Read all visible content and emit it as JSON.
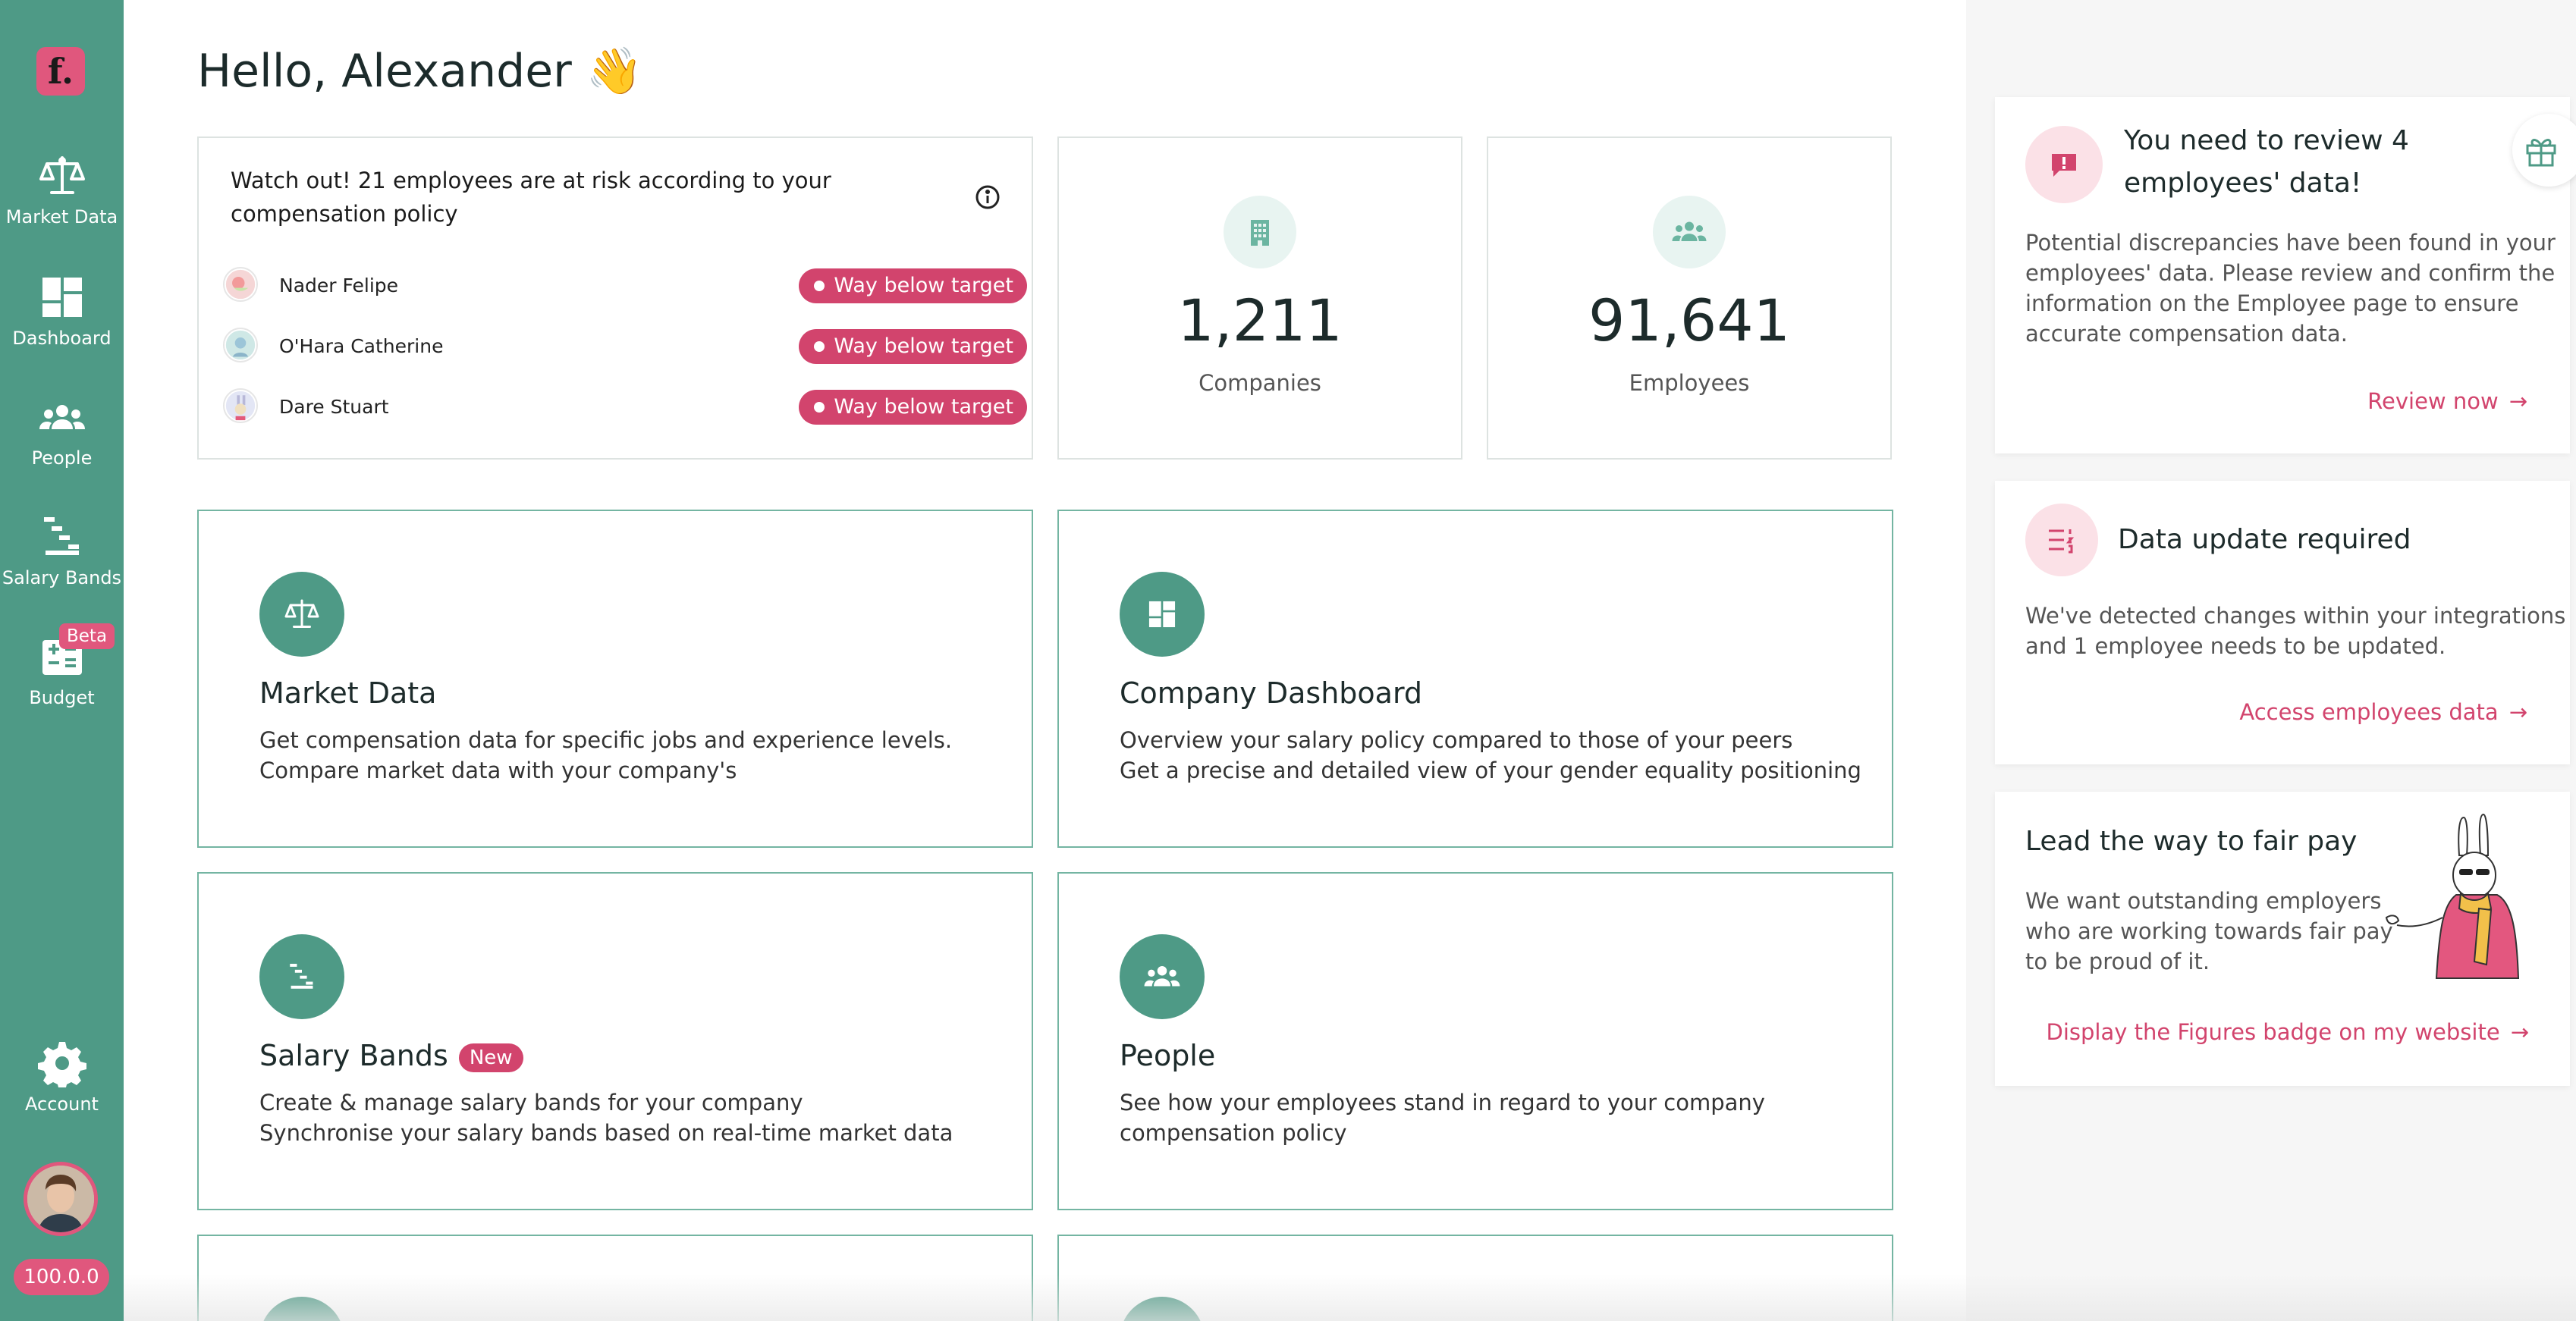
{
  "app": {
    "logo_text": "f.",
    "version": "100.0.0"
  },
  "sidebar": {
    "items": [
      {
        "label": "Market Data",
        "icon": "scale-icon"
      },
      {
        "label": "Dashboard",
        "icon": "dashboard-icon"
      },
      {
        "label": "People",
        "icon": "people-icon"
      },
      {
        "label": "Salary Bands",
        "icon": "salary-bands-icon"
      },
      {
        "label": "Budget",
        "icon": "budget-icon",
        "badge": "Beta"
      },
      {
        "label": "Account",
        "icon": "gear-icon"
      }
    ]
  },
  "greeting": "Hello, Alexander 👋",
  "risk_card": {
    "title": "Watch out! 21 employees are at risk according to your compensation policy",
    "employees": [
      {
        "name": "Nader Felipe",
        "status": "Way below target"
      },
      {
        "name": "O'Hara Catherine",
        "status": "Way below target"
      },
      {
        "name": "Dare Stuart",
        "status": "Way below target"
      }
    ]
  },
  "stats": [
    {
      "value": "1,211",
      "label": "Companies",
      "icon": "building-icon"
    },
    {
      "value": "91,641",
      "label": "Employees",
      "icon": "people-icon"
    }
  ],
  "features": [
    {
      "title": "Market Data",
      "lines": [
        "Get compensation data for specific jobs and experience levels.",
        "Compare market data with your company's"
      ],
      "icon": "scale-icon"
    },
    {
      "title": "Company Dashboard",
      "lines": [
        "Overview your salary policy compared to those of your peers",
        "Get a precise and detailed view of your gender equality positioning"
      ],
      "icon": "dashboard-icon"
    },
    {
      "title": "Salary Bands",
      "badge": "New",
      "lines": [
        "Create & manage salary bands for your company",
        "Synchronise your salary bands based on real-time market data"
      ],
      "icon": "salary-bands-icon"
    },
    {
      "title": "People",
      "lines": [
        "See how your employees stand in regard to your company",
        "compensation policy"
      ],
      "icon": "people-icon"
    }
  ],
  "notifications": {
    "review": {
      "title_line1": "You need to review 4",
      "title_line2": "employees' data!",
      "text": [
        "Potential discrepancies have been found in your",
        "employees' data. Please review and confirm the",
        "information on the Employee page to ensure",
        "accurate compensation data."
      ],
      "link": "Review now"
    },
    "update": {
      "title": "Data update required",
      "text": [
        "We've detected changes within your integrations",
        "and 1 employee needs to be updated."
      ],
      "link": "Access employees data"
    },
    "fair_pay": {
      "title": "Lead the way to fair pay",
      "text": [
        "We want outstanding employers",
        "who are working towards fair pay",
        "to be proud of it."
      ],
      "link": "Display the Figures badge on my website"
    }
  },
  "colors": {
    "sidebar": "#4e9a86",
    "accent": "#d2446d",
    "brand_pink": "#e0577d"
  }
}
